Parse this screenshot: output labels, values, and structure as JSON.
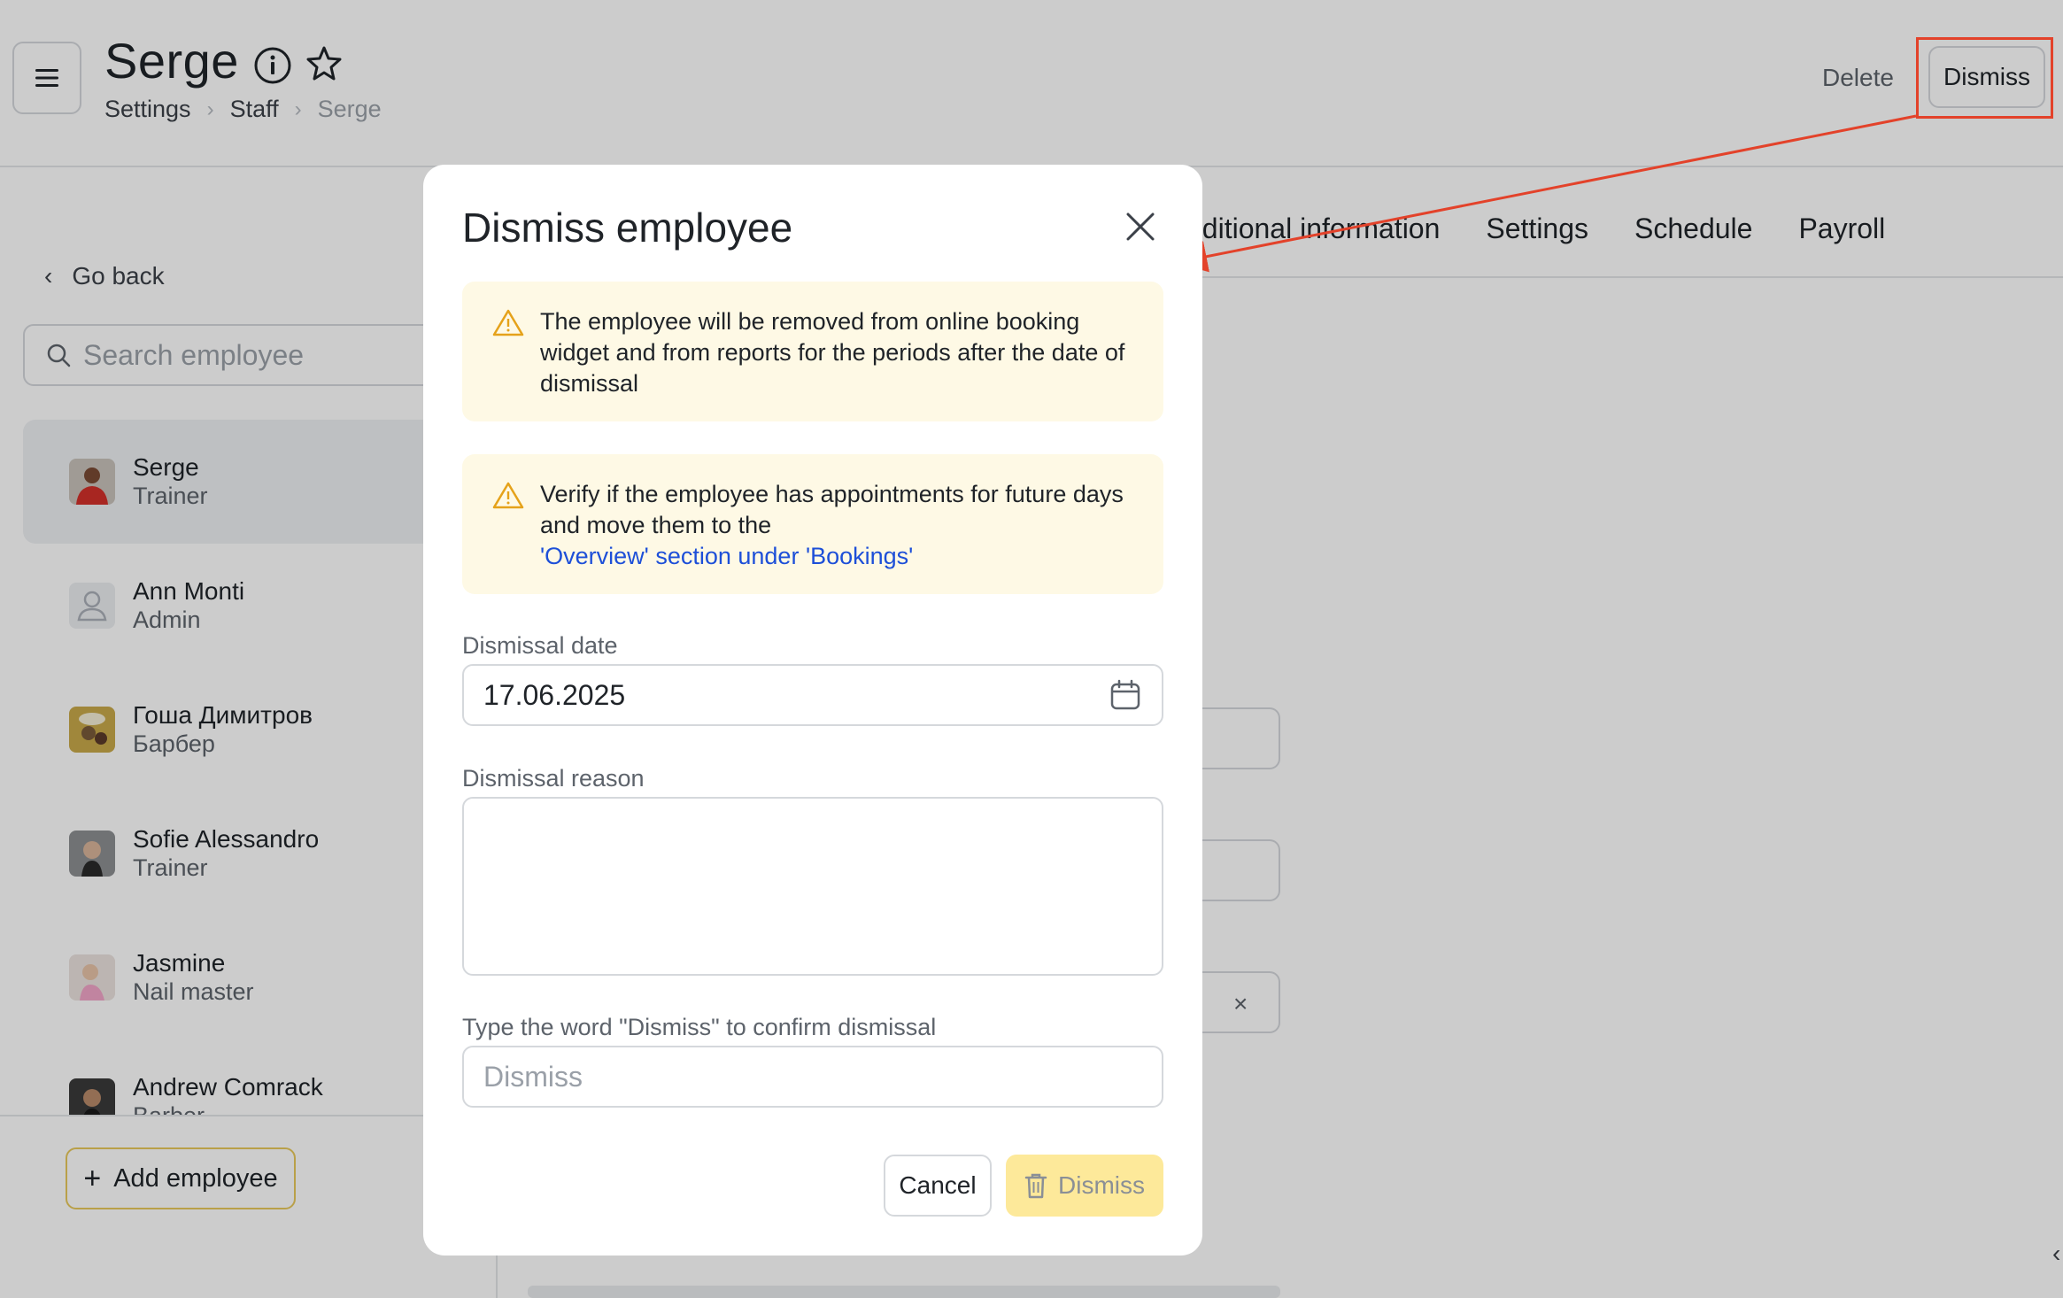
{
  "header": {
    "title": "Serge",
    "breadcrumb": [
      "Settings",
      "Staff",
      "Serge"
    ],
    "delete_label": "Delete",
    "dismiss_label": "Dismiss"
  },
  "tabs": [
    "dditional information",
    "Settings",
    "Schedule",
    "Payroll"
  ],
  "sidebar": {
    "go_back": "Go back",
    "search_placeholder": "Search employee",
    "employees": [
      {
        "name": "Serge",
        "role": "Trainer",
        "active": true
      },
      {
        "name": "Ann Monti",
        "role": "Admin"
      },
      {
        "name": "Гоша Димитров",
        "role": "Барбер"
      },
      {
        "name": "Sofie Alessandro",
        "role": "Trainer"
      },
      {
        "name": "Jasmine",
        "role": "Nail master"
      },
      {
        "name": "Andrew Comrack",
        "role": "Barber"
      }
    ],
    "add_employee": "Add employee"
  },
  "modal": {
    "title": "Dismiss employee",
    "alert1": "The employee will be removed from online booking widget and from reports for the periods after the date of dismissal",
    "alert2_text": "Verify if the employee has appointments for future days and move them to the",
    "alert2_link": "'Overview' section under 'Bookings'",
    "date_label": "Dismissal date",
    "date_value": "17.06.2025",
    "reason_label": "Dismissal reason",
    "reason_value": "",
    "confirm_label": "Type the word \"Dismiss\" to confirm dismissal",
    "confirm_placeholder": "Dismiss",
    "cancel_label": "Cancel",
    "dismiss_label": "Dismiss"
  },
  "colors": {
    "accent_yellow": "#fde99a",
    "alert_bg": "#fef9e5",
    "warning_icon": "#e5a21a",
    "link": "#1d4fd8",
    "annotation_red": "#e3422a"
  }
}
